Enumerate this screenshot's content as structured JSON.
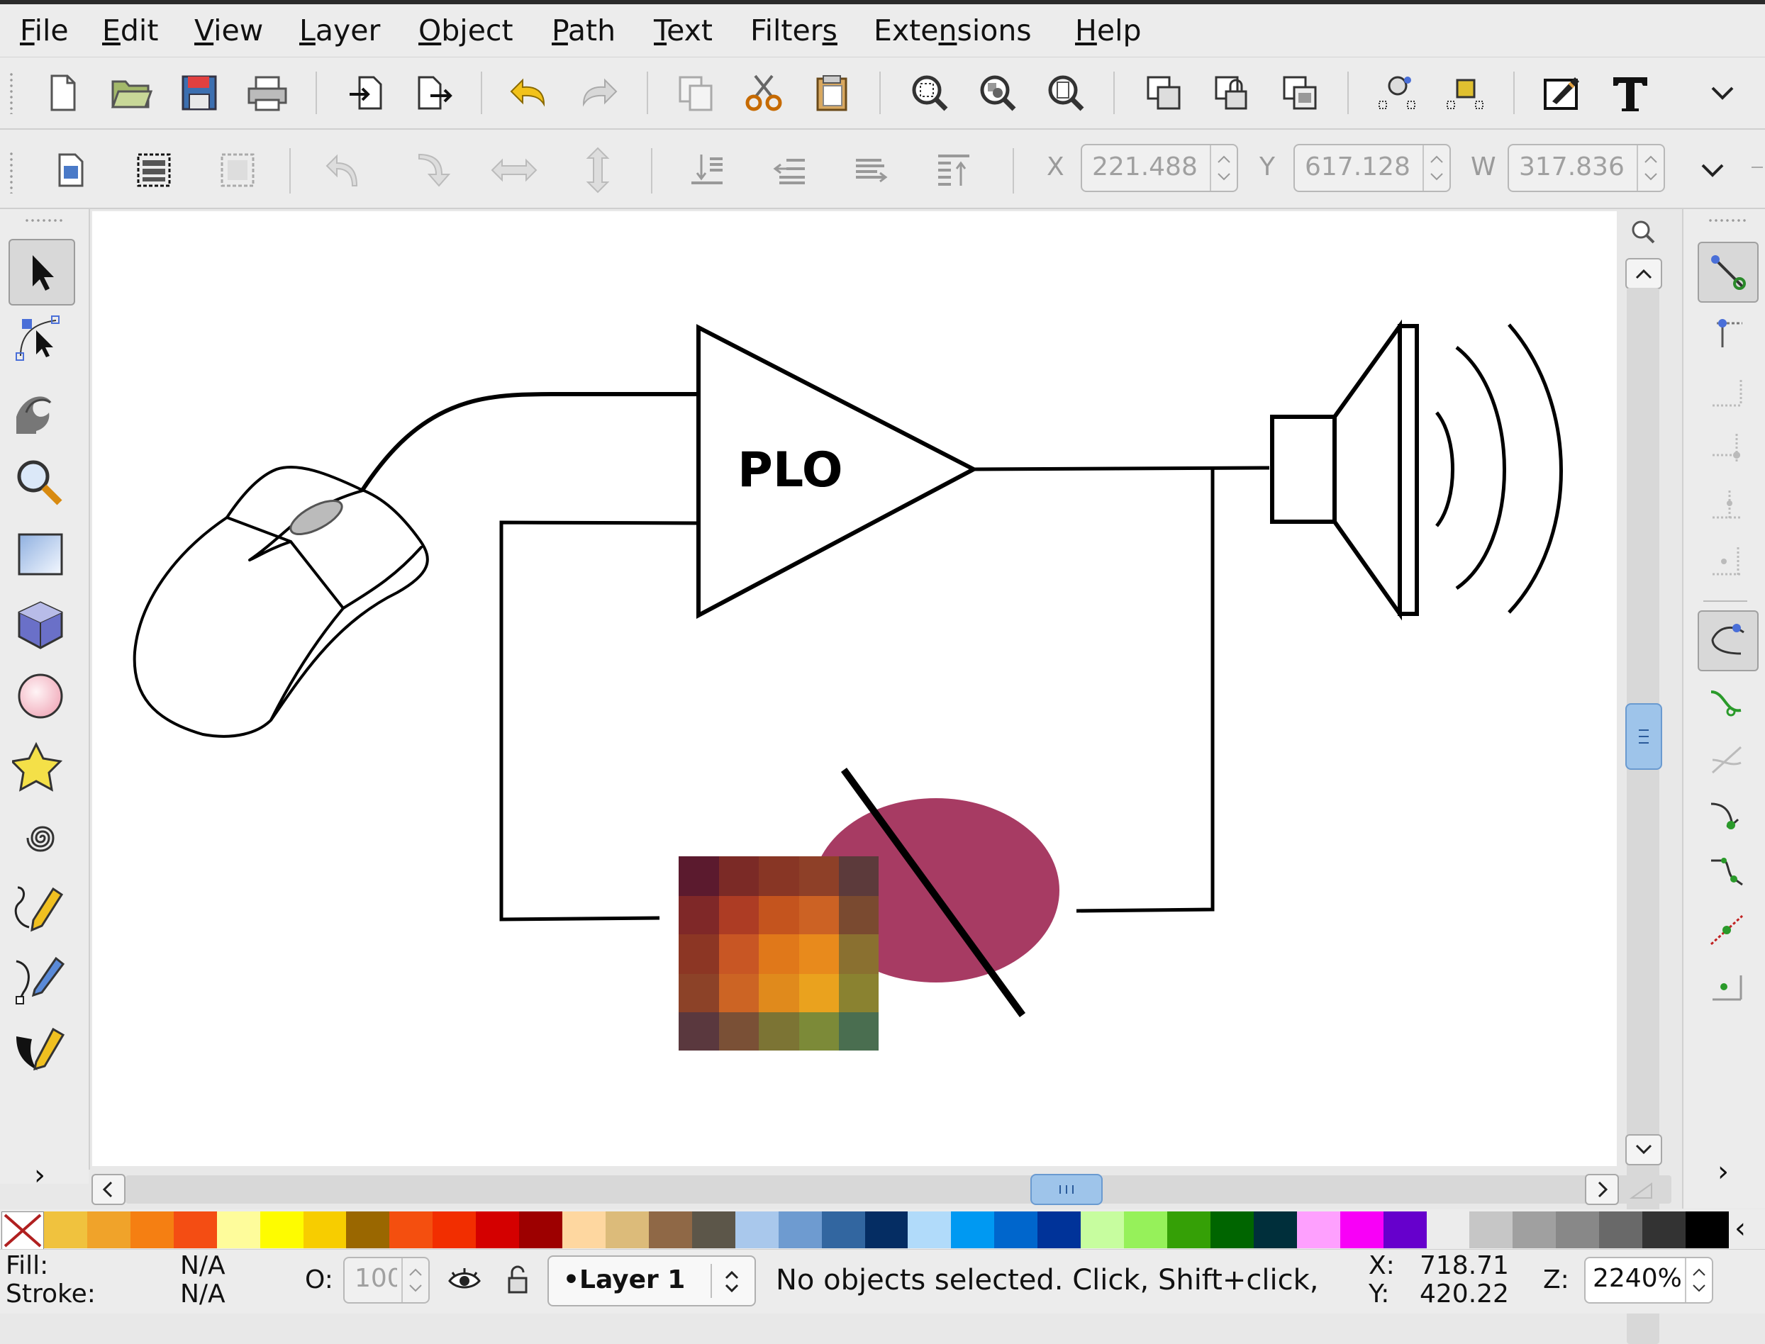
{
  "menu": [
    {
      "key": "F",
      "rest": "ile"
    },
    {
      "key": "E",
      "rest": "dit"
    },
    {
      "key": "V",
      "rest": "iew"
    },
    {
      "key": "L",
      "rest": "ayer"
    },
    {
      "key": "O",
      "rest": "bject"
    },
    {
      "key": "P",
      "rest": "ath"
    },
    {
      "key": "T",
      "rest": "ext"
    },
    {
      "pre": "Filter",
      "key": "s",
      "rest": ""
    },
    {
      "pre": "Exte",
      "key": "n",
      "rest": "sions"
    },
    {
      "key": "H",
      "rest": "elp"
    }
  ],
  "commands_bar": {
    "icons": [
      "new-document-icon",
      "open-icon",
      "save-icon",
      "print-icon",
      "import-icon",
      "export-icon",
      "undo-icon",
      "redo-icon",
      "duplicate-icon",
      "cut-icon",
      "paste-icon",
      "zoom-selection-icon",
      "zoom-drawing-icon",
      "zoom-page-icon",
      "group-icon",
      "lock-icon",
      "ungroup-icon",
      "node-editor-icon",
      "object-properties-icon",
      "fill-stroke-icon",
      "text-tool-icon",
      "overflow-chevron-icon"
    ]
  },
  "controls_bar": {
    "icons": [
      "select-all-icon",
      "select-all-layers-icon",
      "deselect-icon",
      "rotate-ccw-icon",
      "rotate-cw-icon",
      "flip-horizontal-icon",
      "flip-vertical-icon",
      "lower-to-bottom-icon",
      "lower-icon",
      "raise-icon",
      "raise-to-top-icon"
    ],
    "x_label": "X",
    "x_value": "221.488",
    "y_label": "Y",
    "y_value": "617.128",
    "w_label": "W",
    "w_value": "317.836"
  },
  "toolbox": {
    "tools": [
      "selector-arrow-icon",
      "node-tool-icon",
      "tweak-tool-icon",
      "zoom-tool-icon",
      "rectangle-tool-icon",
      "3d-box-tool-icon",
      "ellipse-tool-icon",
      "star-tool-icon",
      "spiral-tool-icon",
      "pencil-tool-icon",
      "pen-tool-icon",
      "calligraphy-tool-icon"
    ],
    "active": "selector-arrow-icon",
    "more": "›"
  },
  "snap_bar": {
    "icons": [
      "snap-enable-icon",
      "snap-bbox-icon",
      "snap-bbox-edge-icon",
      "snap-bbox-corner-icon",
      "snap-bbox-midpoint-icon",
      "snap-bbox-center-icon",
      "snap-nodes-icon",
      "snap-path-icon",
      "snap-path-intersection-icon",
      "snap-cusp-icon",
      "snap-smooth-icon",
      "snap-midpoint-icon",
      "snap-object-center-icon"
    ],
    "more": "›"
  },
  "canvas": {
    "amp_label": "PLO"
  },
  "palette": {
    "colors": [
      "#f0c23e",
      "#f0a32a",
      "#f57f12",
      "#f44d13",
      "#fefc9b",
      "#fefc00",
      "#f7cd00",
      "#9a6700",
      "#f44f0f",
      "#f22e00",
      "#d40000",
      "#9d0000",
      "#fed7a0",
      "#dcbb7a",
      "#8f6846",
      "#5c5649",
      "#a9c8ec",
      "#6e9bd0",
      "#3266a0",
      "#052d63",
      "#b1dbfa",
      "#0099f2",
      "#0066cc",
      "#003399",
      "#c7fd9f",
      "#96f15a",
      "#35a006",
      "#006500",
      "#002f3b",
      "#fea0fe",
      "#f800f7",
      "#6600cc",
      "#ececec",
      "#c6c6c6",
      "#a0a0a0",
      "#888888",
      "#696969",
      "#333333",
      "#000000"
    ]
  },
  "status": {
    "fill_label": "Fill:",
    "fill_value": "N/A",
    "stroke_label": "Stroke:",
    "stroke_value": "N/A",
    "opacity_label": "O:",
    "opacity_value": "100",
    "layer": "•Layer 1",
    "message": "No objects selected. Click, Shift+click,",
    "x_label": "X:",
    "x_value": "718.71",
    "y_label": "Y:",
    "y_value": "420.22",
    "zoom_label": "Z:",
    "zoom_value": "2240%"
  }
}
